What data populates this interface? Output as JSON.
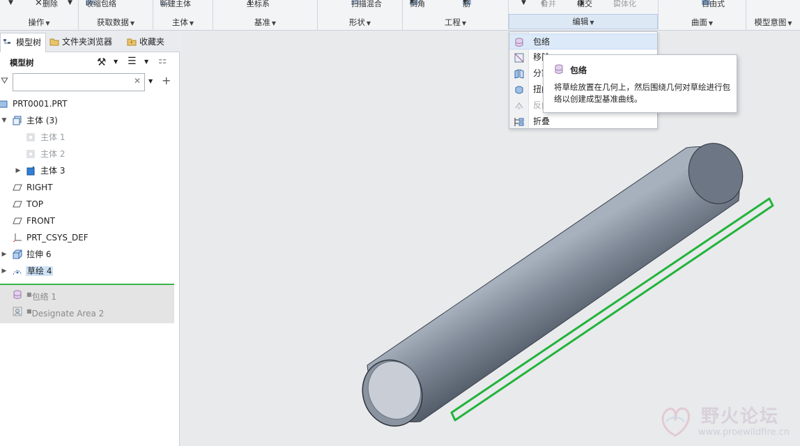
{
  "ribbon": {
    "groups": [
      {
        "label": "操作",
        "top": "删除"
      },
      {
        "label": "获取数据",
        "top": "收缩包络"
      },
      {
        "label": "主体",
        "top": "新建主体"
      },
      {
        "label": "基准",
        "top": "坐标系"
      },
      {
        "label": "形状",
        "top": "扫描混合"
      },
      {
        "label": "工程",
        "top1": "倒角",
        "top2": "筋"
      },
      {
        "label": "编辑",
        "top1": "合并",
        "top2": "相交",
        "top3": "实体化"
      },
      {
        "label": "曲面",
        "top": "自由式"
      },
      {
        "label": "模型意图"
      }
    ]
  },
  "left_panel": {
    "tabs": [
      "模型树",
      "文件夹浏览器",
      "收藏夹"
    ],
    "tree_title": "模型树",
    "filter_placeholder": "",
    "tree": [
      {
        "label": "PRT0001.PRT"
      },
      {
        "label": "主体 (3)"
      },
      {
        "label": "主体 1"
      },
      {
        "label": "主体 2"
      },
      {
        "label": "主体 3"
      },
      {
        "label": "RIGHT"
      },
      {
        "label": "TOP"
      },
      {
        "label": "FRONT"
      },
      {
        "label": "PRT_CSYS_DEF"
      },
      {
        "label": "拉伸 6"
      },
      {
        "label": "草绘 4"
      }
    ],
    "insert_items": [
      "包络 1",
      "Designate Area 2"
    ]
  },
  "dropdown": {
    "items": [
      "包络",
      "移除",
      "分割",
      "扭曲",
      "反向",
      "折叠"
    ]
  },
  "tooltip": {
    "title": "包络",
    "body": "将草绘放置在几何上，然后围绕几何对草绘进行包络以创建成型基准曲线。"
  },
  "watermark": {
    "name": "野火论坛",
    "url": "www.proewildfire.cn"
  },
  "colors": {
    "accent": "#3bb34a",
    "selection": "#cfe3f7",
    "cylinder": "#7d8694"
  }
}
